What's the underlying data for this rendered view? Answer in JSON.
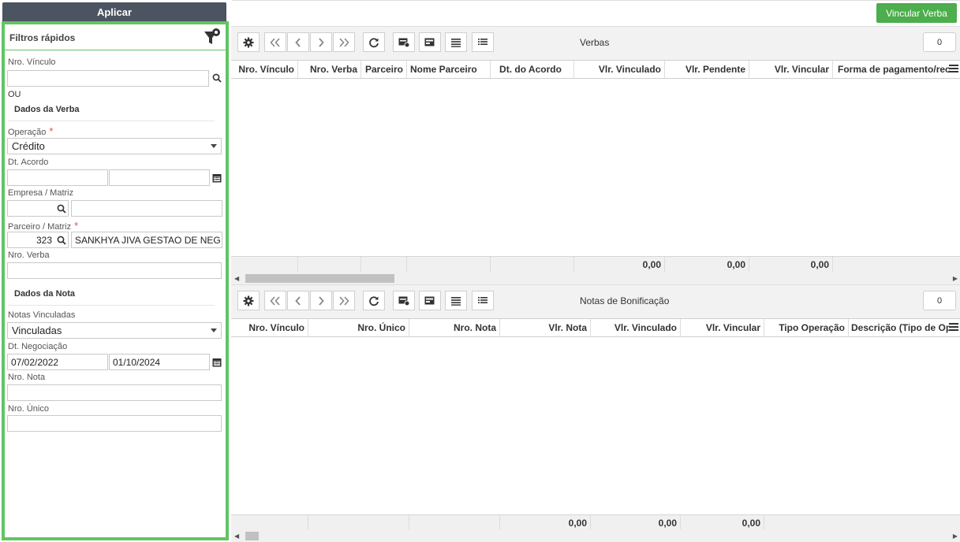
{
  "filters": {
    "apply_label": "Aplicar",
    "title": "Filtros rápidos",
    "nro_vinculo": {
      "label": "Nro. Vínculo",
      "value": ""
    },
    "ou": "OU",
    "section_verba": "Dados da Verba",
    "operacao": {
      "label": "Operação",
      "value": "Crédito"
    },
    "dt_acordo": {
      "label": "Dt. Acordo",
      "from": "",
      "to": ""
    },
    "empresa": {
      "label": "Empresa / Matriz",
      "code": "",
      "name": ""
    },
    "parceiro": {
      "label": "Parceiro / Matriz",
      "code": "323",
      "name": "SANKHYA JIVA GESTAO DE NEG"
    },
    "nro_verba": {
      "label": "Nro. Verba",
      "value": ""
    },
    "section_nota": "Dados da Nota",
    "notas_vinculadas": {
      "label": "Notas Vinculadas",
      "value": "Vinculadas"
    },
    "dt_negociacao": {
      "label": "Dt. Negociação",
      "from": "07/02/2022",
      "to": "01/10/2024"
    },
    "nro_nota": {
      "label": "Nro. Nota",
      "value": ""
    },
    "nro_unico": {
      "label": "Nro. Único",
      "value": ""
    },
    "required_mark": "*"
  },
  "vincular_label": "Vincular Verba",
  "verbas": {
    "title": "Verbas",
    "count": "0",
    "columns": [
      "Nro. Vínculo",
      "Nro. Verba",
      "Parceiro",
      "Nome Parceiro",
      "Dt. do Acordo",
      "Vlr. Vinculado",
      "Vlr. Pendente",
      "Vlr. Vincular",
      "Forma de pagamento/rec"
    ],
    "totals": [
      "0,00",
      "0,00",
      "0,00"
    ]
  },
  "notas": {
    "title": "Notas de Bonificação",
    "count": "0",
    "columns": [
      "Nro. Vínculo",
      "Nro. Único",
      "Nro. Nota",
      "Vlr. Nota",
      "Vlr. Vinculado",
      "Vlr. Vincular",
      "Tipo Operação",
      "Descrição (Tipo de Op"
    ],
    "totals": [
      "0,00",
      "0,00",
      "0,00"
    ]
  },
  "colors": {
    "accent_green": "#4cae4c",
    "panel_border": "#62c462",
    "apply_bg": "#4b5460",
    "required": "#d9534f"
  }
}
